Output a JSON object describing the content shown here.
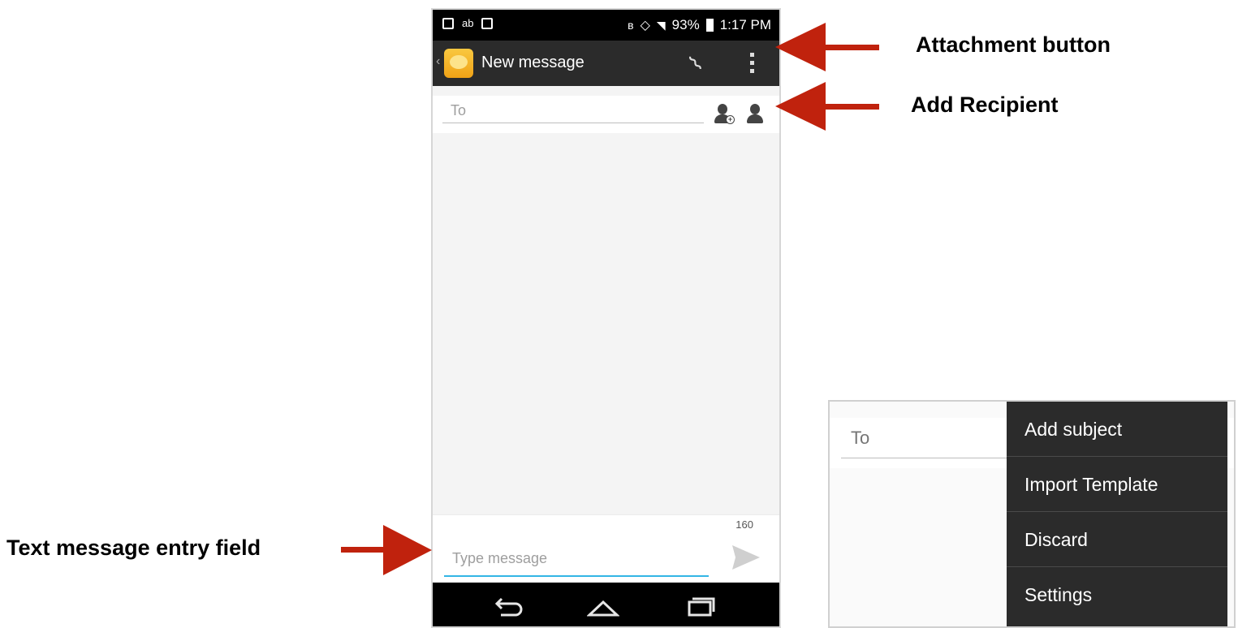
{
  "status_bar": {
    "battery": "93%",
    "time": "1:17 PM"
  },
  "action_bar": {
    "title": "New message"
  },
  "compose": {
    "to_placeholder": "To",
    "char_count": "160",
    "message_placeholder": "Type message"
  },
  "annotations": {
    "attachment": "Attachment button",
    "add_recipient": "Add Recipient",
    "text_entry": "Text message entry field"
  },
  "menu_inset": {
    "to_placeholder": "To",
    "items": [
      "Add subject",
      "Import Template",
      "Discard",
      "Settings"
    ]
  },
  "colors": {
    "arrow": "#c0220d",
    "action_bar": "#2b2b2b",
    "focus_underline": "#33b5e5"
  }
}
